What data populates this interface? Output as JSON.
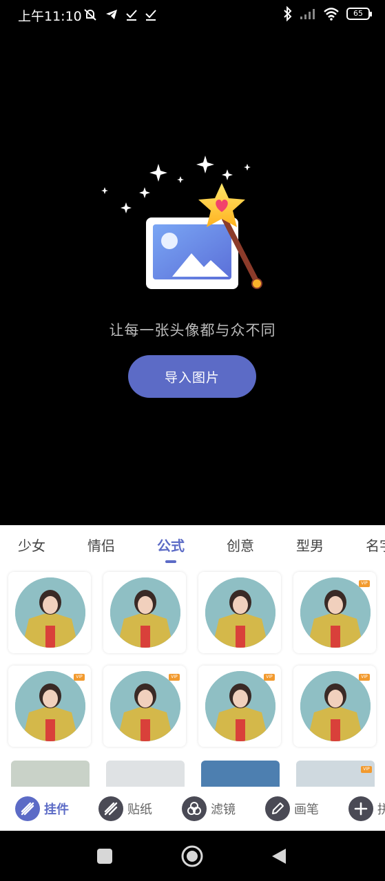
{
  "status_bar": {
    "time": "上午11:10",
    "battery": "65",
    "icons": [
      "mute-bell-icon",
      "telegram-icon",
      "check-icon",
      "check-icon",
      "bluetooth-icon",
      "signal-icon",
      "wifi-icon",
      "battery-icon"
    ]
  },
  "hero": {
    "tagline": "让每一张头像都与众不同",
    "import_button": "导入图片",
    "icons": [
      "sparkle-icon",
      "image-icon",
      "magic-wand-icon"
    ]
  },
  "categories": {
    "tabs": [
      "少女",
      "情侣",
      "公式",
      "创意",
      "型男",
      "名字"
    ],
    "active_index": 2
  },
  "grid": {
    "items": [
      {
        "vip": false
      },
      {
        "vip": false
      },
      {
        "vip": false
      },
      {
        "vip": true
      },
      {
        "vip": true
      },
      {
        "vip": true
      },
      {
        "vip": true
      },
      {
        "vip": true
      }
    ],
    "vip_label": "VIP"
  },
  "toolbar": {
    "tools": [
      "挂件",
      "贴纸",
      "滤镜",
      "画笔",
      "拼"
    ],
    "active_index": 0,
    "icons": [
      "pendant-icon",
      "sticker-icon",
      "filter-icon",
      "brush-icon",
      "add-icon"
    ]
  },
  "navigation": {
    "icons": [
      "recents-square-icon",
      "home-circle-icon",
      "back-triangle-icon"
    ]
  },
  "colors": {
    "accent": "#5c6bc6",
    "background": "#000000",
    "panel": "#ffffff",
    "vip": "#f29a2e"
  }
}
